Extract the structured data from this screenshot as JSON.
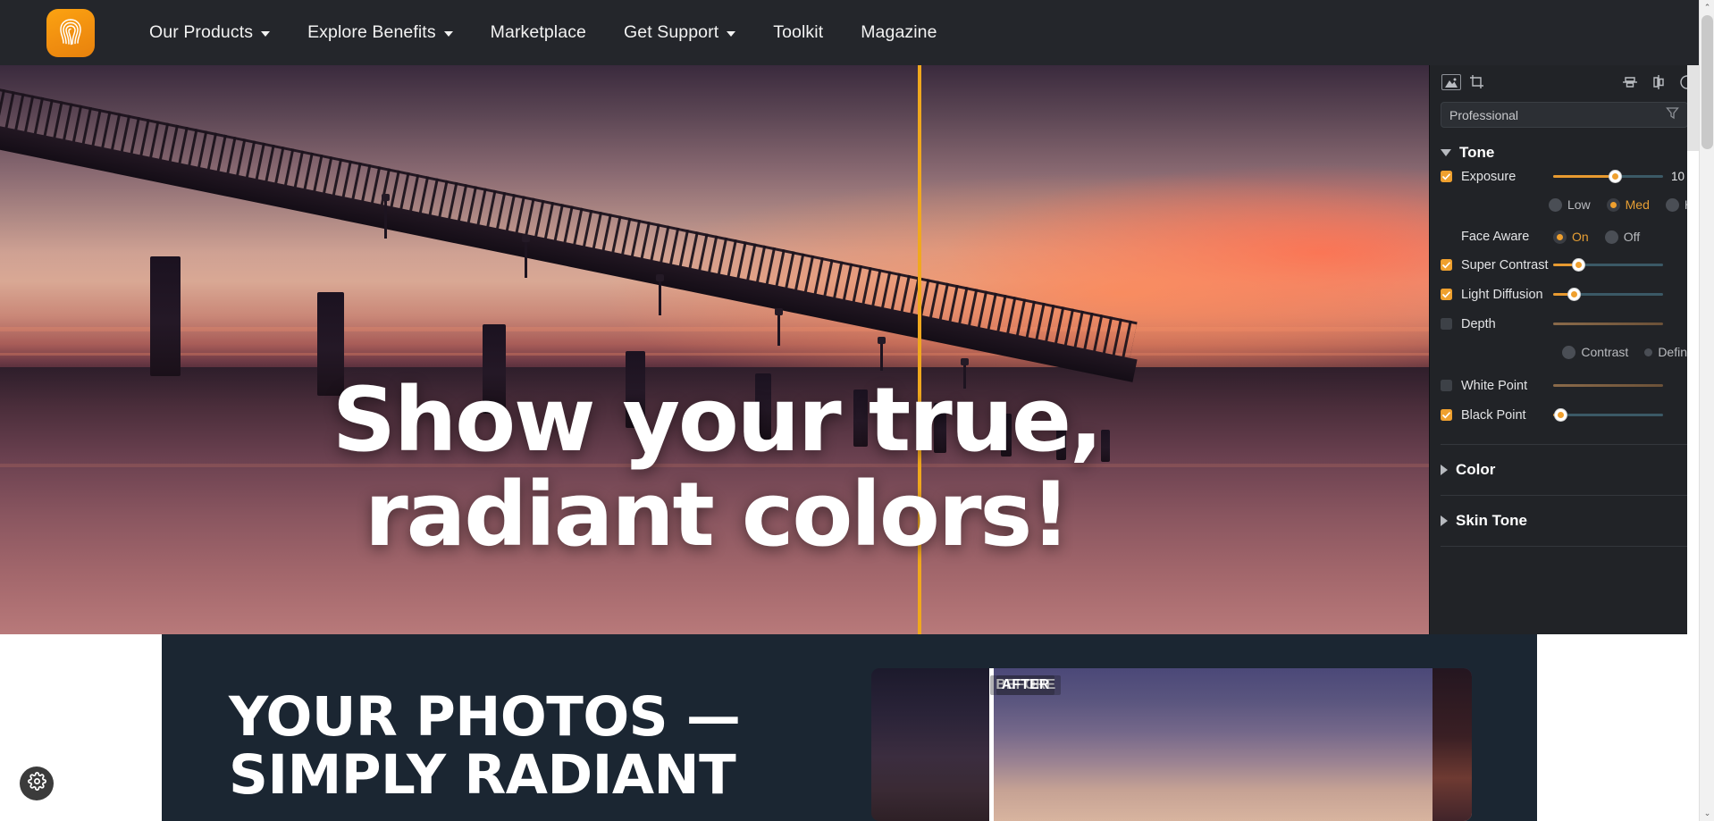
{
  "nav": {
    "logo_icon": "thumbprint-bulb-logo-icon",
    "items": [
      {
        "label": "Our Products",
        "has_caret": true
      },
      {
        "label": "Explore Benefits",
        "has_caret": true
      },
      {
        "label": "Marketplace",
        "has_caret": false
      },
      {
        "label": "Get Support",
        "has_caret": true
      },
      {
        "label": "Toolkit",
        "has_caret": false
      },
      {
        "label": "Magazine",
        "has_caret": false
      }
    ]
  },
  "hero": {
    "headline_line1": "Show your true,",
    "headline_line2": "radiant colors!",
    "split_color": "#f0a81e"
  },
  "editor": {
    "toolbar": {
      "image_icon": "image-icon",
      "crop_icon": "crop-icon",
      "split_horizontal_icon": "compare-split-horizontal-icon",
      "split_vertical_icon": "compare-split-vertical-icon",
      "circle_icon": "compare-circle-icon"
    },
    "preset": {
      "value": "Professional",
      "filter_icon": "filter-funnel-icon"
    },
    "groups": [
      {
        "name": "Tone",
        "expanded": true
      },
      {
        "name": "Color",
        "expanded": false
      },
      {
        "name": "Skin Tone",
        "expanded": false
      }
    ],
    "controls": {
      "exposure": {
        "label": "Exposure",
        "checked": true,
        "value": "10",
        "fill_pct": 56,
        "knob_pct": 56
      },
      "exposure_strength": {
        "options": [
          {
            "label": "Low",
            "selected": false
          },
          {
            "label": "Med",
            "selected": true
          },
          {
            "label": "H",
            "selected": false
          }
        ]
      },
      "face_aware": {
        "label": "Face Aware",
        "options": [
          {
            "label": "On",
            "selected": true
          },
          {
            "label": "Off",
            "selected": false
          }
        ]
      },
      "super_contrast": {
        "label": "Super Contrast",
        "checked": true,
        "fill_pct": 23,
        "knob_pct": 23
      },
      "light_diffusion": {
        "label": "Light Diffusion",
        "checked": true,
        "fill_pct": 19,
        "knob_pct": 19
      },
      "depth": {
        "label": "Depth",
        "checked": false,
        "fill_pct": 0,
        "knob_pct": -1
      },
      "depth_mode": {
        "options": [
          {
            "label": "Contrast",
            "selected": false
          },
          {
            "label": "Definit",
            "selected": false
          }
        ]
      },
      "white_point": {
        "label": "White Point",
        "checked": false,
        "fill_pct": 0,
        "knob_pct": -1
      },
      "black_point": {
        "label": "Black Point",
        "checked": true,
        "fill_pct": 5,
        "knob_pct": 5
      }
    },
    "accent_color": "#efa02e"
  },
  "lower": {
    "heading_line1": "YOUR PHOTOS —",
    "heading_line2": "SIMPLY RADIANT",
    "before_after": {
      "before_label": "BEFORE",
      "after_label": "AFTER"
    },
    "background_color": "#1b2632"
  },
  "gear": {
    "icon": "gear-icon"
  },
  "scrollbars": {
    "page_up_arrow": "⌃",
    "page_down_arrow": "⌄"
  }
}
